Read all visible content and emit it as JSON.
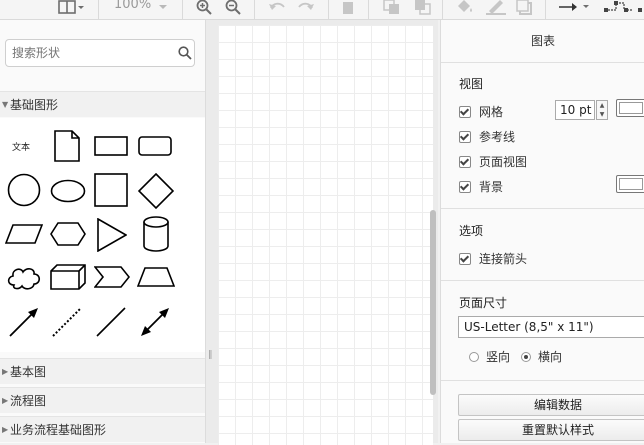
{
  "toolbar": {
    "zoom_label": "100%",
    "icons": [
      "format-panel-icon",
      "zoom-in-icon",
      "zoom-out-icon",
      "undo-icon",
      "redo-icon",
      "delete-icon",
      "to-front-icon",
      "to-back-icon",
      "fill-color-icon",
      "line-color-icon",
      "shadow-icon",
      "connection-arrow-icon",
      "waypoints-icon"
    ]
  },
  "sidebar": {
    "search_placeholder": "搜索形状",
    "sections": [
      {
        "label": "基础图形",
        "expanded": true
      },
      {
        "label": "基本图",
        "expanded": false
      },
      {
        "label": "流程图",
        "expanded": false
      },
      {
        "label": "业务流程基础图形",
        "expanded": false
      }
    ],
    "text_shape_label": "文本"
  },
  "panel": {
    "title": "图表",
    "view": {
      "heading": "视图",
      "grid_label": "网格",
      "grid_size": "10 pt",
      "guides_label": "参考线",
      "page_view_label": "页面视图",
      "background_label": "背景"
    },
    "options": {
      "heading": "选项",
      "connection_arrows_label": "连接箭头"
    },
    "page_size": {
      "heading": "页面尺寸",
      "format_value": "US-Letter (8,5\" x 11\")",
      "portrait_label": "竖向",
      "landscape_label": "横向",
      "selected": "landscape"
    },
    "edit_data_label": "编辑数据",
    "reset_style_label": "重置默认样式"
  },
  "colors": {
    "accent": "#444444",
    "canvas_bg": "#ebebeb",
    "panel_bg": "#fafafa"
  }
}
